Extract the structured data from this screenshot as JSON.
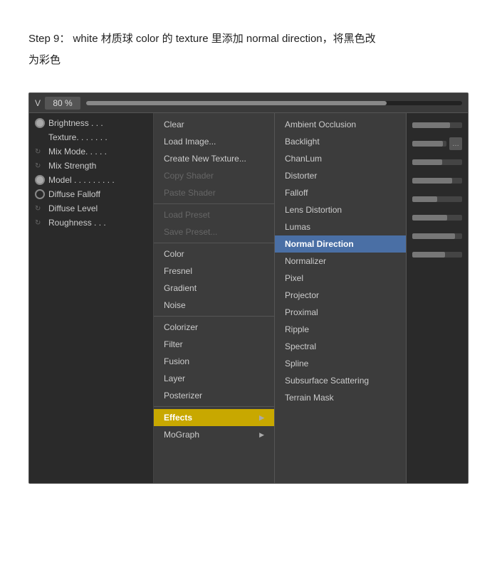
{
  "instruction": {
    "line1": "Step 9： white 材质球 color 的 texture 里添加 normal direction，将黑色改",
    "line2": "为彩色"
  },
  "topbar": {
    "label": "V",
    "value": "80 %"
  },
  "left_panel": {
    "items": [
      {
        "type": "bullet-filled",
        "text": "Brightness . . ."
      },
      {
        "type": "plain",
        "text": "Texture. . . . . . ."
      },
      {
        "type": "dash",
        "text": "Mix Mode. . . . ."
      },
      {
        "type": "dash",
        "text": "Mix Strength"
      },
      {
        "type": "bullet-filled",
        "text": "Model . . . . . . . . ."
      },
      {
        "type": "bullet",
        "text": "Diffuse Falloff"
      },
      {
        "type": "dash",
        "text": "Diffuse Level"
      },
      {
        "type": "dash",
        "text": "Roughness . . ."
      }
    ]
  },
  "menu_col1": {
    "items": [
      {
        "label": "Clear",
        "type": "normal"
      },
      {
        "label": "Load Image...",
        "type": "normal"
      },
      {
        "label": "Create New Texture...",
        "type": "normal"
      },
      {
        "label": "Copy Shader",
        "type": "disabled"
      },
      {
        "label": "Paste Shader",
        "type": "disabled"
      },
      {
        "label": "separator"
      },
      {
        "label": "Load Preset",
        "type": "disabled"
      },
      {
        "label": "Save Preset...",
        "type": "disabled"
      },
      {
        "label": "separator"
      },
      {
        "label": "Color",
        "type": "normal"
      },
      {
        "label": "Fresnel",
        "type": "normal"
      },
      {
        "label": "Gradient",
        "type": "normal"
      },
      {
        "label": "Noise",
        "type": "normal"
      },
      {
        "label": "separator"
      },
      {
        "label": "Colorizer",
        "type": "normal"
      },
      {
        "label": "Filter",
        "type": "normal"
      },
      {
        "label": "Fusion",
        "type": "normal"
      },
      {
        "label": "Layer",
        "type": "normal"
      },
      {
        "label": "Posterizer",
        "type": "normal"
      },
      {
        "label": "separator"
      },
      {
        "label": "Effects",
        "type": "highlighted",
        "has_sub": true
      },
      {
        "label": "MoGraph",
        "type": "normal",
        "has_sub": true
      }
    ]
  },
  "menu_col2": {
    "items": [
      {
        "label": "Ambient Occlusion",
        "type": "normal"
      },
      {
        "label": "Backlight",
        "type": "normal"
      },
      {
        "label": "ChanLum",
        "type": "normal"
      },
      {
        "label": "Distorter",
        "type": "normal"
      },
      {
        "label": "Falloff",
        "type": "normal"
      },
      {
        "label": "Lens Distortion",
        "type": "normal"
      },
      {
        "label": "Lumas",
        "type": "normal"
      },
      {
        "label": "Normal Direction",
        "type": "selected"
      },
      {
        "label": "Normalizer",
        "type": "normal"
      },
      {
        "label": "Pixel",
        "type": "normal"
      },
      {
        "label": "Projector",
        "type": "normal"
      },
      {
        "label": "Proximal",
        "type": "normal"
      },
      {
        "label": "Ripple",
        "type": "normal"
      },
      {
        "label": "Spectral",
        "type": "normal"
      },
      {
        "label": "Spline",
        "type": "normal"
      },
      {
        "label": "Subsurface Scattering",
        "type": "normal"
      },
      {
        "label": "Terrain Mask",
        "type": "normal"
      }
    ]
  },
  "sliders": [
    {
      "fill": "75%"
    },
    {
      "fill": "90%"
    },
    {
      "fill": "60%"
    },
    {
      "fill": "80%"
    },
    {
      "fill": "50%"
    },
    {
      "fill": "70%"
    },
    {
      "fill": "85%"
    },
    {
      "fill": "65%"
    }
  ]
}
